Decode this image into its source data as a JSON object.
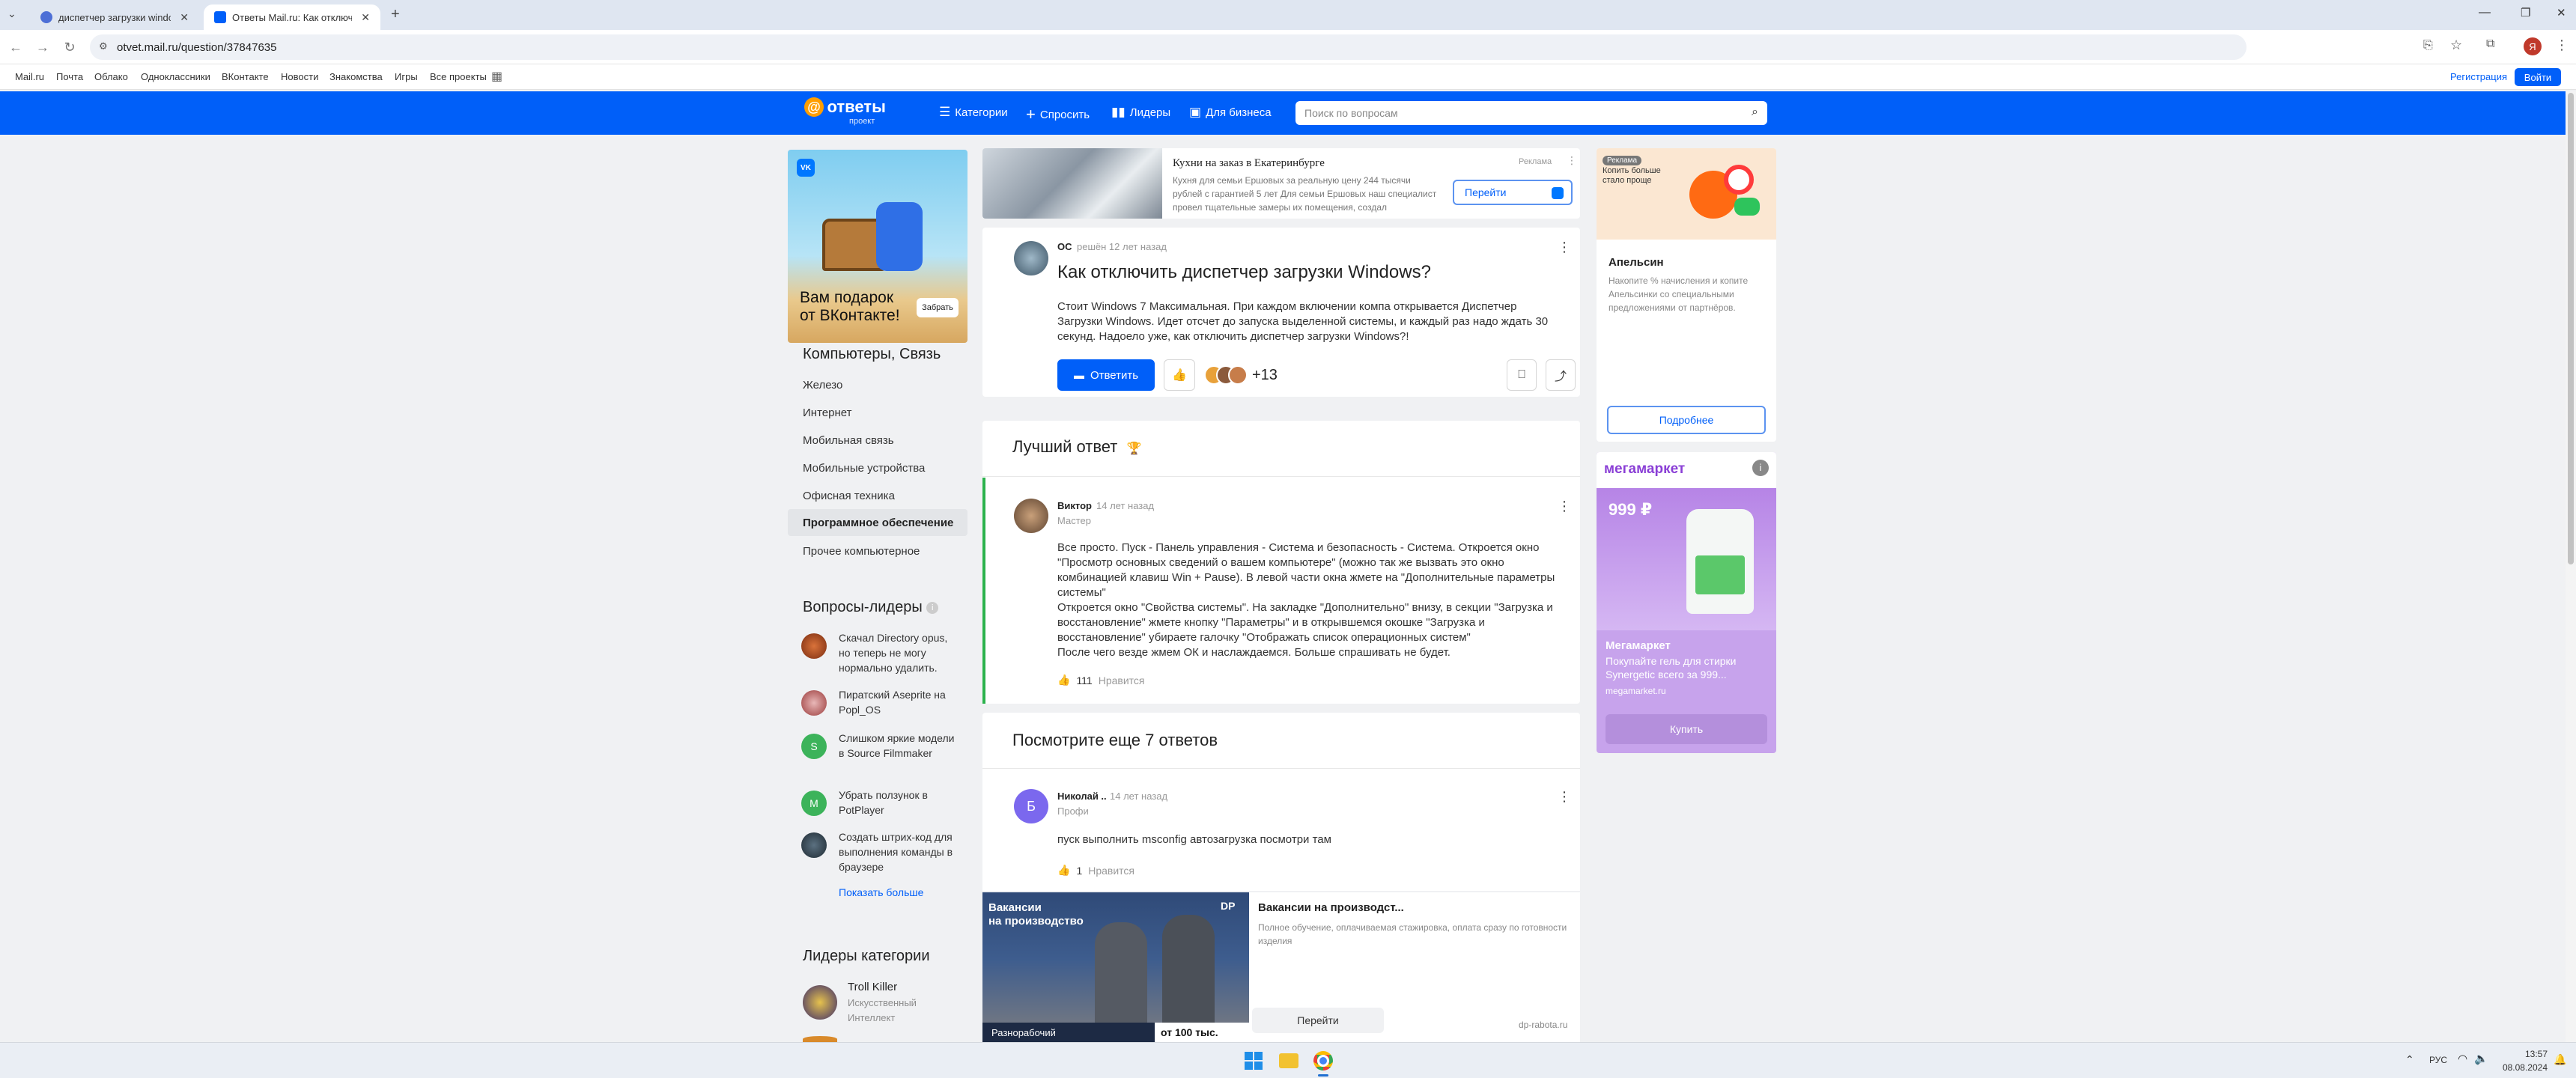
{
  "browser": {
    "tabs": [
      {
        "title": "диспетчер загрузки windows",
        "active": false
      },
      {
        "title": "Ответы Mail.ru: Как отключить...",
        "active": true
      }
    ],
    "new_tab": "+",
    "url": "otvet.mail.ru/question/37847635",
    "bookmarks": [
      "Mail.ru",
      "Почта",
      "Облако",
      "Одноклассники",
      "ВКонтакте",
      "Новости",
      "Знакомства",
      "Игры",
      "Все проекты"
    ],
    "register": "Регистрация",
    "login": "Войти"
  },
  "header": {
    "logo": "ответы",
    "logo_sub": "проект",
    "nav": [
      "Категории",
      "Спросить",
      "Лидеры",
      "Для бизнеса"
    ],
    "search_placeholder": "Поиск по вопросам"
  },
  "left": {
    "ad": {
      "line1": "Вам подарок",
      "line2": "от ВКонтакте!",
      "button": "Забрать",
      "brand": "VK"
    },
    "category_title": "Компьютеры, Связь",
    "categories": [
      "Железо",
      "Интернет",
      "Мобильная связь",
      "Мобильные устройства",
      "Офисная техника",
      "Программное обеспечение",
      "Прочее компьютерное"
    ],
    "active_category": "Программное обеспечение",
    "leaders_questions_title": "Вопросы-лидеры",
    "leader_questions": [
      "Скачал Directory opus, но теперь не могу нормально удалить.",
      "Пиратский Aseprite на Popl_OS",
      "Слишком яркие модели в Source Filmmaker",
      "Убрать ползунок в PotPlayer",
      "Создать штрих-код для выполнения команды в браузере"
    ],
    "leader_letters": [
      "",
      "",
      "S",
      "M",
      ""
    ],
    "show_more": "Показать больше",
    "category_leaders_title": "Лидеры категории",
    "category_leaders": [
      {
        "name": "Troll Killer",
        "rank": "Искусственный Интеллект"
      }
    ]
  },
  "top_ad": {
    "title": "Кухни на заказ в Екатеринбурге",
    "text": "Кухня для семьи Ершовых за реальную цену 244 тысячи рублей с гарантией 5 лет Для семьи Ершовых наш специалист провел тщательные замеры их помещения, создал",
    "label": "Реклама",
    "button": "Перейти"
  },
  "question": {
    "author": "ОС",
    "meta": "решён 12 лет назад",
    "title": "Как отключить диспетчер загрузки Windows?",
    "text": "Стоит Windows 7 Максимальная. При каждом включении компа открывается Диспетчер Загрузки Windows. Идет отсчет до запуска выделенной системы, и каждый раз надо ждать 30 секунд. Надоело уже, как отключить диспетчер загрузки Windows?!",
    "answer_button": "Ответить",
    "likers_more": "+13"
  },
  "best_answer": {
    "section_title": "Лучший ответ",
    "author": "Виктор",
    "time": "14 лет назад",
    "rank": "Мастер",
    "text_lines": [
      "Все просто. Пуск - Панель управления - Система и безопасность - Система. Откроется окно \"Просмотр основных сведений о вашем компьютере\" (можно так же вызвать это окно комбинацией клавиш Win + Pause). В левой части окна жмете на \"Дополнительные параметры системы\"",
      "Откроется окно \"Свойства системы\". На закладке \"Дополнительно\" внизу, в секции \"Загрузка и восстановление\" жмете кнопку \"Параметры\" и в открывшемся окошке \"Загрузка и восстановление\" убираете галочку \"Отображать список операционных систем\"",
      "После чего везде жмем ОК и наслаждаемся. Больше спрашивать не будет."
    ],
    "likes": "111",
    "like_label": "Нравится"
  },
  "more_answers": {
    "section_title": "Посмотрите еще 7 ответов",
    "items": [
      {
        "avatar_letter": "Б",
        "author": "Николай ..",
        "time": "14 лет назад",
        "rank": "Профи",
        "text": "пуск выполнить msconfig автозагрузка посмотри там",
        "likes": "1",
        "like_label": "Нравится"
      }
    ]
  },
  "bottom_ad": {
    "img_line1": "Вакансии",
    "img_line2": "на производство",
    "img_job": "Разнорабочий",
    "img_salary": "от 100 тыс.",
    "img_badge": "DP",
    "title": "Вакансии на производст...",
    "text": "Полное обучение, оплачиваемая стажировка, оплата сразу по готовности изделия",
    "button": "Перейти",
    "domain": "dp-rabota.ru"
  },
  "right_ad1": {
    "label": "Реклама",
    "promo": "Копить больше стало проще",
    "brand": "Апельсин",
    "text": "Накопите % начисления и копите Апельсинки со специальными предложениями от партнёров.",
    "button": "Подробнее"
  },
  "right_ad2": {
    "brand": "мегамаркет",
    "price": "999 ₽",
    "title": "Мегамаркет",
    "text": "Покупайте гель для стирки Synergetic всего за 999...",
    "domain": "megamarket.ru",
    "button": "Купить"
  },
  "taskbar": {
    "lang": "РУС",
    "time": "13:57",
    "date": "08.08.2024"
  }
}
